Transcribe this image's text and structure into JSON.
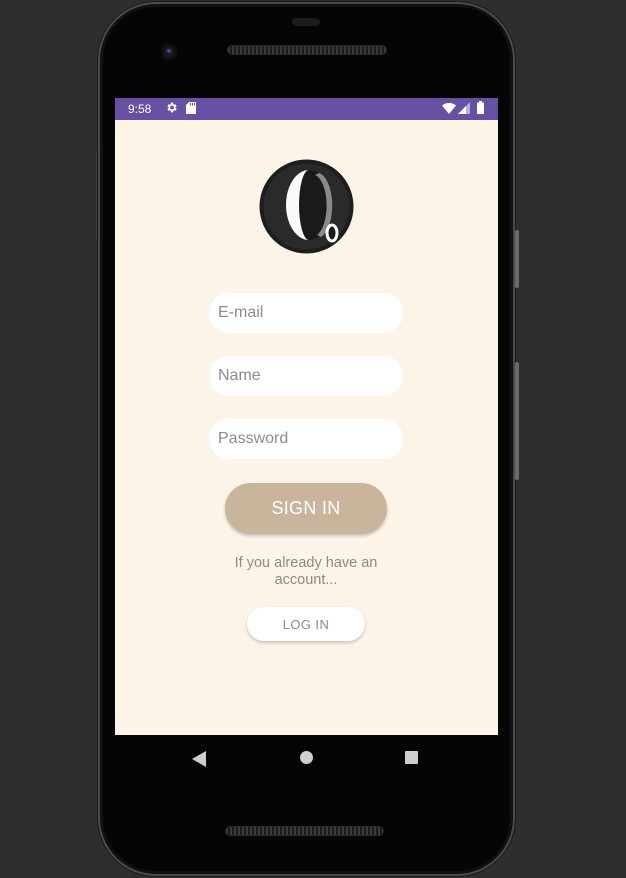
{
  "status_bar": {
    "time": "9:58",
    "icons": [
      "settings-icon",
      "sd-card-icon",
      "wifi-icon",
      "cell-signal-icon",
      "battery-icon"
    ],
    "background_color": "#6750a4"
  },
  "app": {
    "background_color": "#fdf4e8",
    "logo": "letter-q-logo"
  },
  "form": {
    "email_placeholder": "E-mail",
    "name_placeholder": "Name",
    "password_placeholder": "Password",
    "signin_label": "SIGN IN",
    "signin_color": "#c9b59b",
    "hint_text": "If you already have an account...",
    "login_label": "LOG IN"
  },
  "nav_bar": {
    "buttons": [
      "back-icon",
      "home-icon",
      "recent-apps-icon"
    ]
  }
}
